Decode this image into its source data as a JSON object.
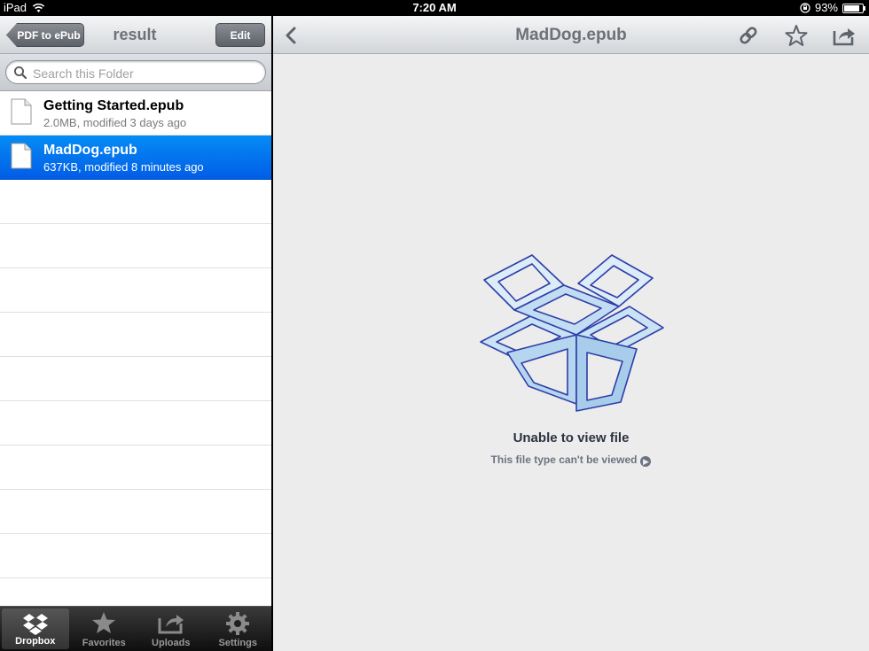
{
  "status_bar": {
    "device": "iPad",
    "time": "7:20 AM",
    "battery": "93%",
    "battery_level": 0.93
  },
  "left_nav": {
    "back_label": "PDF to ePub",
    "title": "result",
    "edit_label": "Edit"
  },
  "search": {
    "placeholder": "Search this Folder"
  },
  "files": [
    {
      "name": "Getting Started.epub",
      "meta": "2.0MB, modified 3 days ago",
      "selected": false
    },
    {
      "name": "MadDog.epub",
      "meta": "637KB, modified 8 minutes ago",
      "selected": true
    }
  ],
  "tabs": [
    {
      "label": "Dropbox",
      "icon": "dropbox-icon",
      "active": true
    },
    {
      "label": "Favorites",
      "icon": "star-icon",
      "active": false
    },
    {
      "label": "Uploads",
      "icon": "upload-icon",
      "active": false
    },
    {
      "label": "Settings",
      "icon": "gear-icon",
      "active": false
    }
  ],
  "viewer": {
    "title": "MadDog.epub",
    "message_title": "Unable to view file",
    "message_sub": "This file type can't be viewed"
  },
  "colors": {
    "selection": "#0270eb",
    "nav_title": "#6d7279",
    "viewer_bg": "#ececec"
  }
}
